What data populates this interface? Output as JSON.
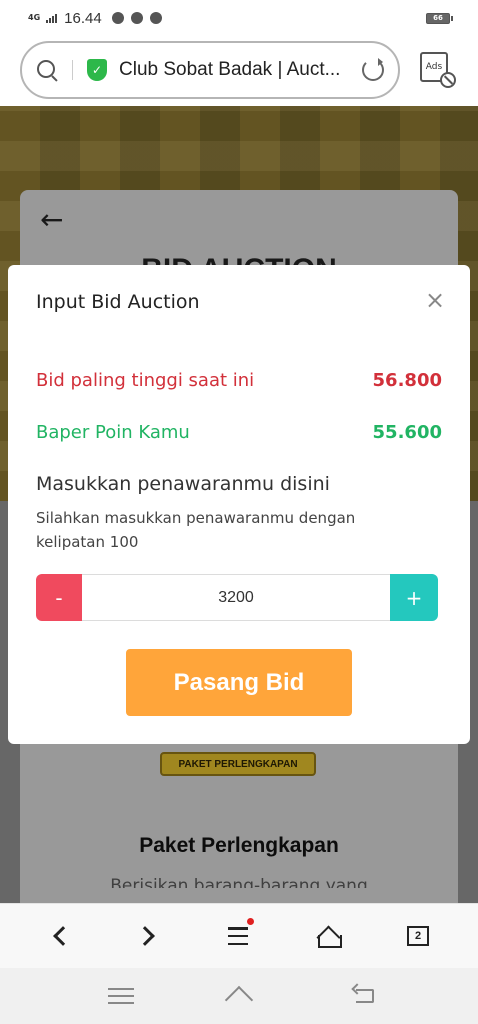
{
  "status_bar": {
    "network": "4G",
    "time": "16.44",
    "battery": "66"
  },
  "browser": {
    "url_title": "Club Sobat Badak | Auct...",
    "ads_label": "Ads",
    "tab_count": "2"
  },
  "page": {
    "heading": "BID AUCTION",
    "badge": "PAKET PERLENGKAPAN",
    "item_title": "Paket Perlengkapan",
    "item_desc": "Berisikan barang-barang yang"
  },
  "modal": {
    "title": "Input Bid Auction",
    "close_symbol": "×",
    "highest_bid_label": "Bid paling tinggi saat ini",
    "highest_bid_value": "56.800",
    "points_label": "Baper Poin Kamu",
    "points_value": "55.600",
    "enter_label": "Masukkan penawaranmu disini",
    "enter_hint": "Silahkan masukkan penawaranmu dengan kelipatan 100",
    "minus_label": "-",
    "bid_value": "3200",
    "plus_label": "+",
    "submit_label": "Pasang Bid"
  },
  "colors": {
    "highest_bid": "#d2303a",
    "points": "#21b463",
    "minus_button": "#f04a5e",
    "plus_button": "#24c8be",
    "submit_button": "#ffa53a",
    "secure_shield": "#2db84a"
  },
  "icons": {
    "back": "arrow-left-icon",
    "close": "close-icon",
    "search": "search-icon",
    "reload": "reload-icon",
    "shield": "shield-check-icon"
  }
}
